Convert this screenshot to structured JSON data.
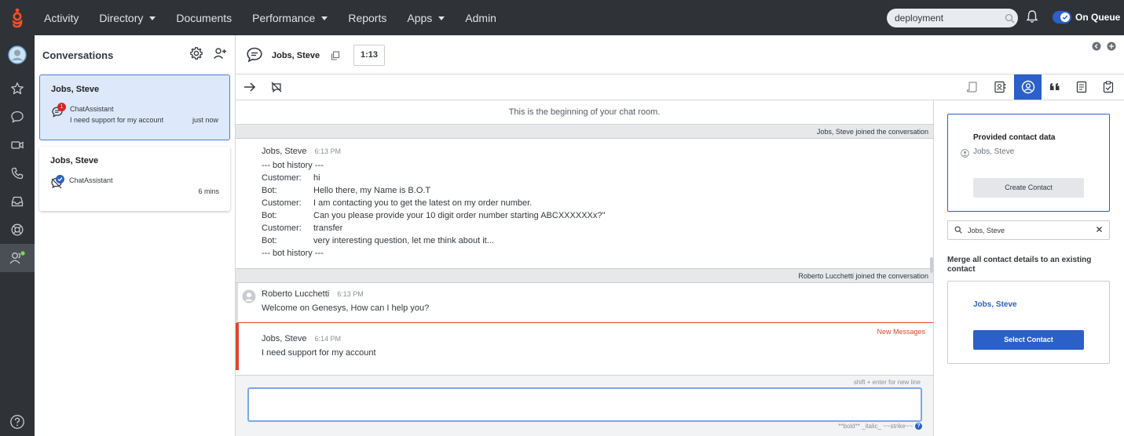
{
  "nav": {
    "items": [
      {
        "label": "Activity",
        "dropdown": false
      },
      {
        "label": "Directory",
        "dropdown": true
      },
      {
        "label": "Documents",
        "dropdown": false
      },
      {
        "label": "Performance",
        "dropdown": true
      },
      {
        "label": "Reports",
        "dropdown": false
      },
      {
        "label": "Apps",
        "dropdown": true
      },
      {
        "label": "Admin",
        "dropdown": false
      }
    ],
    "search_value": "deployment",
    "queue_label": "On Queue",
    "queue_on": true
  },
  "sidebar": {
    "icons": [
      "avatar",
      "star-icon",
      "chat-icon",
      "video-icon",
      "phone-icon",
      "inbox-icon",
      "lifebuoy-icon",
      "agent-icon",
      "help-icon"
    ]
  },
  "conversations": {
    "title": "Conversations",
    "items": [
      {
        "name": "Jobs, Steve",
        "channel": "ChatAssistant",
        "preview": "I need support for my account",
        "time": "just now",
        "badge": "1"
      },
      {
        "name": "Jobs, Steve",
        "channel": "ChatAssistant",
        "preview": "",
        "time": "6 mins",
        "badge": ""
      }
    ]
  },
  "header": {
    "contact_name": "Jobs, Steve",
    "timer": "1:13"
  },
  "chat": {
    "begin_text": "This is the beginning of your chat room.",
    "joined_1": "Jobs, Steve joined the conversation",
    "bot_msg": {
      "sender": "Jobs, Steve",
      "time": "6:13 PM",
      "history_start": "--- bot history ---",
      "rows": [
        {
          "who": "Customer:",
          "text": "hi"
        },
        {
          "who": "Bot:",
          "text": "Hello there, my Name is B.O.T"
        },
        {
          "who": "Customer:",
          "text": "I am contacting you to get the latest on my order number."
        },
        {
          "who": "Bot:",
          "text": "Can you please provide your 10 digit order number starting ABCXXXXXXx?\""
        },
        {
          "who": "Customer:",
          "text": "transfer"
        },
        {
          "who": "Bot:",
          "text": "very interesting question, let me think about it..."
        }
      ],
      "history_end": "--- bot history ---"
    },
    "joined_2": "Roberto Lucchetti joined the conversation",
    "agent_msg": {
      "sender": "Roberto Lucchetti",
      "time": "6:13 PM",
      "text": "Welcome on Genesys, How can I help you?"
    },
    "new_messages": "New Messages",
    "customer_msg": {
      "sender": "Jobs, Steve",
      "time": "6:14 PM",
      "text": "I need support for my account"
    },
    "hint": "shift + enter for new line",
    "format_hint": "**bold** _italic_ ~~strike~~"
  },
  "contact_panel": {
    "provided_title": "Provided contact data",
    "provided_name": "Jobs, Steve",
    "create_label": "Create Contact",
    "search_value": "Jobs, Steve",
    "merge_title": "Merge all contact details to an existing contact",
    "match_name": "Jobs, Steve",
    "select_label": "Select Contact"
  },
  "colors": {
    "accent": "#2a60c8",
    "topbar": "#2f3338",
    "new_messages": "#e2452b",
    "selected_card": "#dde8fb"
  }
}
